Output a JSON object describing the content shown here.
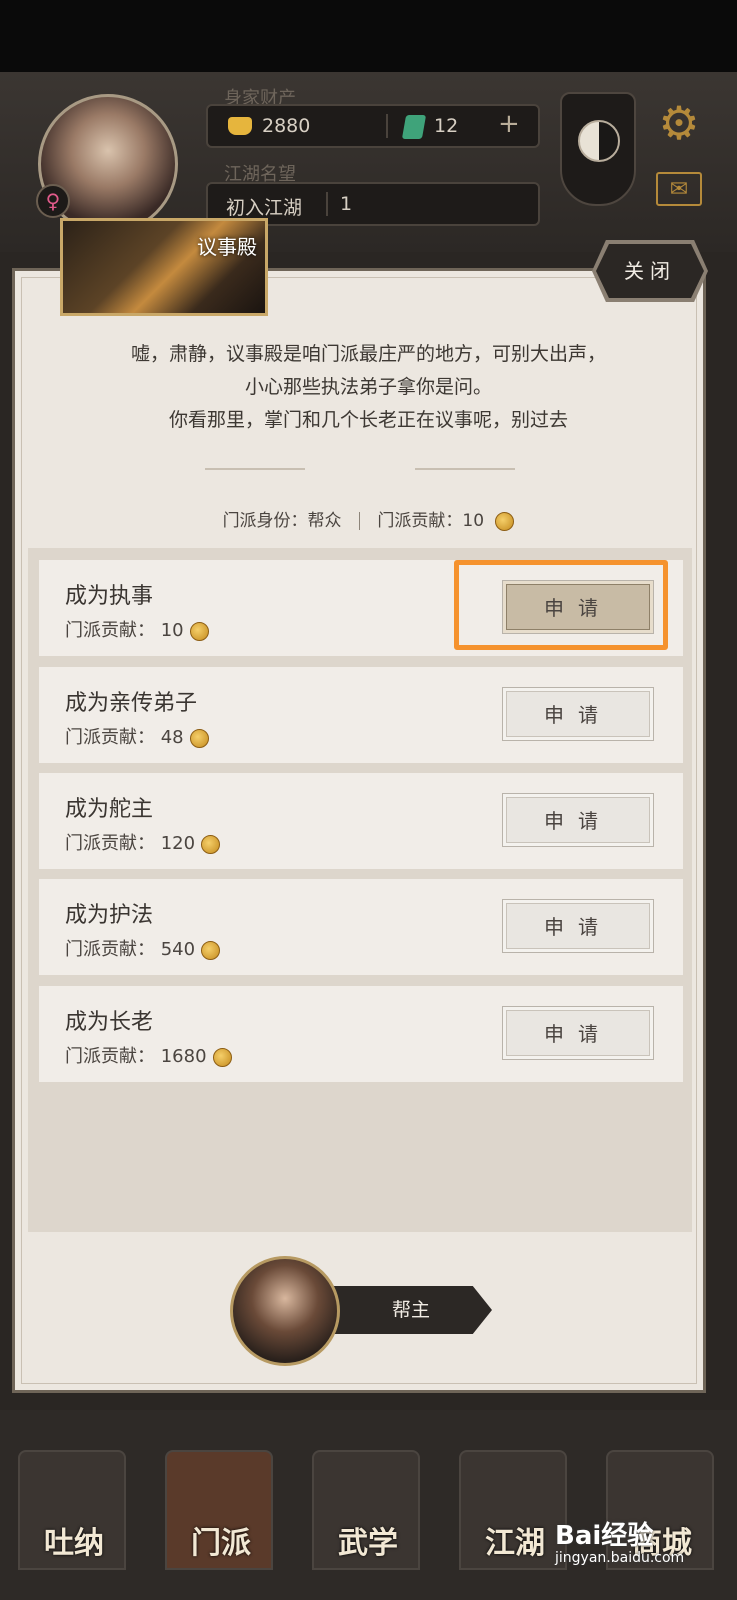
{
  "header": {
    "wealth_label": "身家财产",
    "gold": "2880",
    "jade": "12",
    "add": "+",
    "reputation_label": "江湖名望",
    "reputation_rank": "初入江湖",
    "reputation_level": "1",
    "gender_symbol": "♀"
  },
  "scene": {
    "title": "议事殿",
    "close_label": "关闭",
    "narration": [
      "嘘，肃静，议事殿是咱门派最庄严的地方，可别大出声，",
      "小心那些执法弟子拿你是问。",
      "你看那里，掌门和几个长老正在议事呢，别过去"
    ],
    "identity_label": "门派身份：帮众",
    "contribution_label": "门派贡献：10"
  },
  "positions": [
    {
      "title": "成为执事",
      "cost": "门派贡献：  10",
      "button": "申请"
    },
    {
      "title": "成为亲传弟子",
      "cost": "门派贡献：  48",
      "button": "申请"
    },
    {
      "title": "成为舵主",
      "cost": "门派贡献：  120",
      "button": "申请"
    },
    {
      "title": "成为护法",
      "cost": "门派贡献：  540",
      "button": "申请"
    },
    {
      "title": "成为长老",
      "cost": "门派贡献：  1680",
      "button": "申请"
    }
  ],
  "leader": {
    "label": "帮主"
  },
  "nav": [
    "吐纳",
    "门派",
    "武学",
    "江湖",
    "商城"
  ],
  "watermark": {
    "brand": "Bai经验",
    "url": "jingyan.baidu.com"
  }
}
